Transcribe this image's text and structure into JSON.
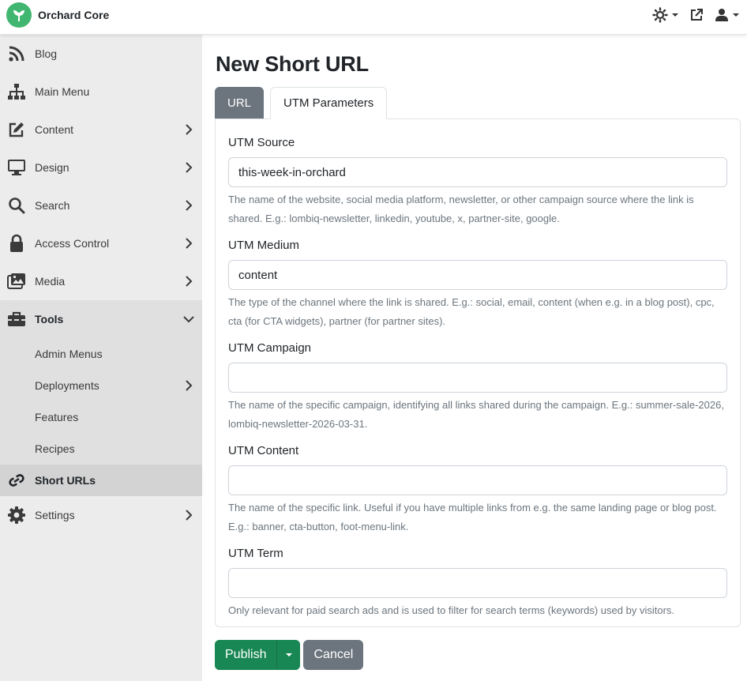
{
  "app": {
    "brand_name": "Orchard Core"
  },
  "topbar": {
    "icons": [
      "theme-icon",
      "external-link-icon",
      "user-icon"
    ]
  },
  "sidebar": {
    "items": [
      {
        "label": "Blog",
        "icon": "rss-icon"
      },
      {
        "label": "Main Menu",
        "icon": "sitemap-icon"
      },
      {
        "label": "Content",
        "icon": "edit-icon"
      },
      {
        "label": "Design",
        "icon": "desktop-icon"
      },
      {
        "label": "Search",
        "icon": "search-icon"
      },
      {
        "label": "Access Control",
        "icon": "lock-icon"
      },
      {
        "label": "Media",
        "icon": "images-icon"
      },
      {
        "label": "Tools",
        "icon": "toolbox-icon"
      },
      {
        "label": "Settings",
        "icon": "gear-icon"
      }
    ],
    "tools_children": [
      {
        "label": "Admin Menus"
      },
      {
        "label": "Deployments"
      },
      {
        "label": "Features"
      },
      {
        "label": "Recipes"
      },
      {
        "label": "Short URLs",
        "icon": "link-icon"
      }
    ]
  },
  "main": {
    "title": "New Short URL",
    "tabs": [
      {
        "label": "URL"
      },
      {
        "label": "UTM Parameters"
      }
    ],
    "fields": [
      {
        "label": "UTM Source",
        "value": "this-week-in-orchard",
        "help": "The name of the website, social media platform, newsletter, or other campaign source where the link is shared. E.g.: lombiq-newsletter, linkedin, youtube, x, partner-site, google."
      },
      {
        "label": "UTM Medium",
        "value": "content",
        "help": "The type of the channel where the link is shared. E.g.: social, email, content (when e.g. in a blog post), cpc, cta (for CTA widgets), partner (for partner sites)."
      },
      {
        "label": "UTM Campaign",
        "value": "",
        "help": "The name of the specific campaign, identifying all links shared during the campaign. E.g.: summer-sale-2026, lombiq-newsletter-2026-03-31."
      },
      {
        "label": "UTM Content",
        "value": "",
        "help": "The name of the specific link. Useful if you have multiple links from e.g. the same landing page or blog post. E.g.: banner, cta-button, foot-menu-link."
      },
      {
        "label": "UTM Term",
        "value": "",
        "help": "Only relevant for paid search ads and is used to filter for search terms (keywords) used by visitors."
      }
    ],
    "actions": {
      "publish_label": "Publish",
      "cancel_label": "Cancel"
    }
  },
  "colors": {
    "brand_green": "#41b670",
    "publish_green": "#198754",
    "secondary_gray": "#6c757d",
    "sidebar_bg": "#ececec"
  }
}
